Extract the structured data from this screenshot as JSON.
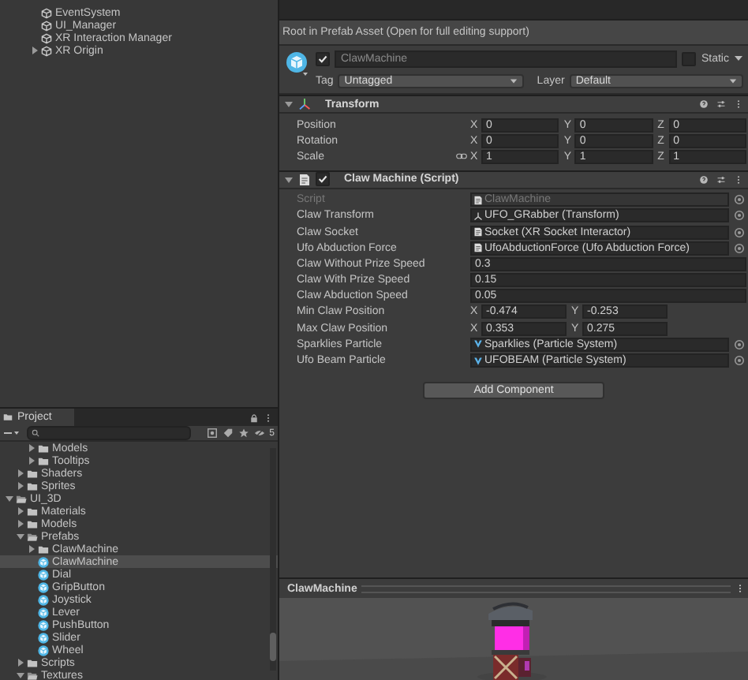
{
  "hierarchy": {
    "items": [
      {
        "name": "EventSystem",
        "kind": "leaf"
      },
      {
        "name": "UI_Manager",
        "kind": "leaf"
      },
      {
        "name": "XR Interaction Manager",
        "kind": "leaf"
      },
      {
        "name": "XR Origin",
        "kind": "parent",
        "expanded": false
      }
    ]
  },
  "project": {
    "tab": "Project",
    "hidden_count": "5",
    "tree": [
      {
        "children": [
          {
            "children": [
              {
                "name": "Models",
                "kind": "folder",
                "expanded": false,
                "selected": false
              },
              {
                "name": "Tooltips",
                "kind": "folder",
                "expanded": false,
                "selected": false
              }
            ]
          },
          {
            "name": "Shaders",
            "kind": "folder",
            "expanded": false,
            "selected": false
          },
          {
            "name": "Sprites",
            "kind": "folder",
            "expanded": false,
            "selected": false
          }
        ]
      },
      {
        "name": "UI_3D",
        "kind": "folder",
        "expanded": true,
        "selected": false,
        "children": [
          {
            "name": "Materials",
            "kind": "folder",
            "expanded": false,
            "selected": false
          },
          {
            "name": "Models",
            "kind": "folder",
            "expanded": false,
            "selected": false
          },
          {
            "name": "Prefabs",
            "kind": "folder",
            "expanded": true,
            "selected": false,
            "children": [
              {
                "name": "ClawMachine",
                "kind": "folder",
                "expanded": false,
                "selected": false
              },
              {
                "name": "ClawMachine",
                "kind": "prefab",
                "selected": true
              },
              {
                "name": "Dial",
                "kind": "prefab",
                "selected": false
              },
              {
                "name": "GripButton",
                "kind": "prefab",
                "selected": false
              },
              {
                "name": "Joystick",
                "kind": "prefab",
                "selected": false
              },
              {
                "name": "Lever",
                "kind": "prefab",
                "selected": false
              },
              {
                "name": "PushButton",
                "kind": "prefab",
                "selected": false
              },
              {
                "name": "Slider",
                "kind": "prefab",
                "selected": false
              },
              {
                "name": "Wheel",
                "kind": "prefab",
                "selected": false
              }
            ]
          },
          {
            "name": "Scripts",
            "kind": "folder",
            "expanded": false,
            "selected": false
          },
          {
            "name": "Textures",
            "kind": "folder",
            "expanded": true,
            "selected": false
          }
        ]
      }
    ]
  },
  "inspector": {
    "banner": "Root in Prefab Asset (Open for full editing support)",
    "object": {
      "name": "ClawMachine",
      "active": true,
      "static_label": "Static",
      "static": false,
      "tag_label": "Tag",
      "tag": "Untagged",
      "layer_label": "Layer",
      "layer": "Default"
    },
    "components": [
      {
        "kind": "transform",
        "title": "Transform",
        "expanded": true,
        "fields": [
          {
            "label": "Position",
            "kind": "vector",
            "link": false,
            "disabled": false,
            "values": [
              {
                "axis": "X",
                "value": "0"
              },
              {
                "axis": "Y",
                "value": "0"
              },
              {
                "axis": "Z",
                "value": "0"
              }
            ]
          },
          {
            "label": "Rotation",
            "kind": "vector",
            "link": false,
            "disabled": false,
            "values": [
              {
                "axis": "X",
                "value": "0"
              },
              {
                "axis": "Y",
                "value": "0"
              },
              {
                "axis": "Z",
                "value": "0"
              }
            ]
          },
          {
            "label": "Scale",
            "kind": "vector",
            "link": true,
            "disabled": false,
            "values": [
              {
                "axis": "X",
                "value": "1"
              },
              {
                "axis": "Y",
                "value": "1"
              },
              {
                "axis": "Z",
                "value": "1"
              }
            ]
          }
        ]
      },
      {
        "kind": "script",
        "title": "Claw Machine (Script)",
        "expanded": true,
        "enabled": true,
        "fields": [
          {
            "label": "Script",
            "kind": "script_ref",
            "value": "ClawMachine",
            "disabled": true
          },
          {
            "label": "Claw Transform",
            "kind": "transform_ref",
            "value": "UFO_GRabber (Transform)",
            "disabled": false
          },
          {
            "label": "Claw Socket",
            "kind": "script_ref",
            "value": "Socket (XR Socket Interactor)",
            "disabled": false
          },
          {
            "label": "Ufo Abduction Force",
            "kind": "script_ref",
            "value": "UfoAbductionForce (Ufo Abduction Force)",
            "disabled": false
          },
          {
            "label": "Claw Without Prize Speed",
            "kind": "number",
            "value": "0.3",
            "disabled": false
          },
          {
            "label": "Claw With Prize Speed",
            "kind": "number",
            "value": "0.15",
            "disabled": false
          },
          {
            "label": "Claw Abduction Speed",
            "kind": "number",
            "value": "0.05",
            "disabled": false
          },
          {
            "label": "Min Claw Position",
            "kind": "vector",
            "link": false,
            "disabled": false,
            "values": [
              {
                "axis": "X",
                "value": "-0.474"
              },
              {
                "axis": "Y",
                "value": "-0.253"
              }
            ]
          },
          {
            "label": "Max Claw Position",
            "kind": "vector",
            "link": false,
            "disabled": false,
            "values": [
              {
                "axis": "X",
                "value": "0.353"
              },
              {
                "axis": "Y",
                "value": "0.275"
              }
            ]
          },
          {
            "label": "Sparklies Particle",
            "kind": "particle_ref",
            "value": "Sparklies (Particle System)",
            "disabled": false
          },
          {
            "label": "Ufo Beam Particle",
            "kind": "particle_ref",
            "value": "UFOBEAM (Particle System)",
            "disabled": false
          }
        ]
      }
    ],
    "add_button": "Add Component",
    "preview": {
      "title": "ClawMachine",
      "kind": "picture"
    }
  }
}
